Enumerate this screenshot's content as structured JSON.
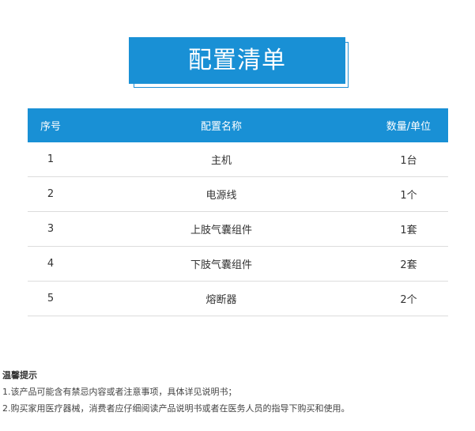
{
  "title": "配置清单",
  "table": {
    "headers": {
      "no": "序号",
      "name": "配置名称",
      "qty": "数量/单位"
    },
    "rows": [
      {
        "no": "1",
        "name": "主机",
        "qty": "1台"
      },
      {
        "no": "2",
        "name": "电源线",
        "qty": "1个"
      },
      {
        "no": "3",
        "name": "上肢气囊组件",
        "qty": "1套"
      },
      {
        "no": "4",
        "name": "下肢气囊组件",
        "qty": "2套"
      },
      {
        "no": "5",
        "name": "熔断器",
        "qty": "2个"
      }
    ]
  },
  "notes": {
    "heading": "温馨提示",
    "items": [
      "1.该产品可能含有禁忌内容或者注意事项，具体详见说明书；",
      "2.购买家用医疗器械，消费者应仔细阅读产品说明书或者在医务人员的指导下购买和使用。"
    ]
  },
  "colors": {
    "accent": "#1990d5",
    "row_border": "#dcdcdc"
  }
}
